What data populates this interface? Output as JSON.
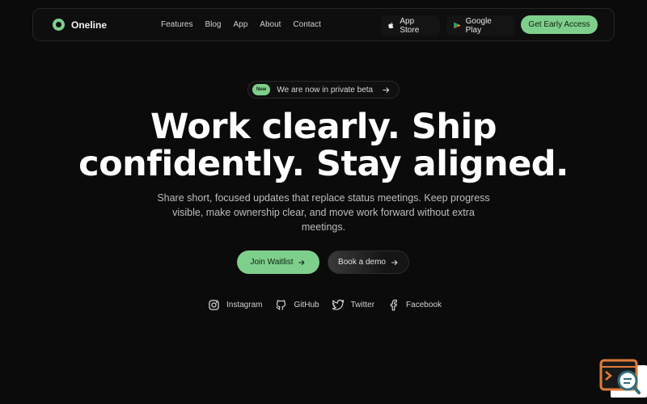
{
  "brand": {
    "name": "Oneline",
    "accent": "#7fcf8c"
  },
  "nav": {
    "links": [
      "Features",
      "Blog",
      "App",
      "About",
      "Contact"
    ],
    "app_store": {
      "label": "App Store",
      "icon": "apple-icon"
    },
    "google_play": {
      "label": "Google Play",
      "icon": "google-play-icon"
    },
    "cta": "Get Early Access"
  },
  "hero": {
    "badge": "New",
    "announcement": "We are now in private beta",
    "headline": [
      "Work clearly. Ship",
      "confidently. Stay aligned."
    ],
    "subtext": "Share short, focused updates that replace status meetings. Keep progress visible, make ownership clear, and move work forward without extra meetings.",
    "primary_button": "Join Waitlist",
    "secondary_button": "Book a demo"
  },
  "socials": [
    {
      "label": "Instagram",
      "icon": "instagram-icon"
    },
    {
      "label": "GitHub",
      "icon": "github-icon"
    },
    {
      "label": "Twitter",
      "icon": "twitter-icon"
    },
    {
      "label": "Facebook",
      "icon": "facebook-icon"
    }
  ],
  "colors": {
    "background": "#0b0b0b",
    "accent": "#7fcf8c",
    "widget": "#e07b3a"
  }
}
